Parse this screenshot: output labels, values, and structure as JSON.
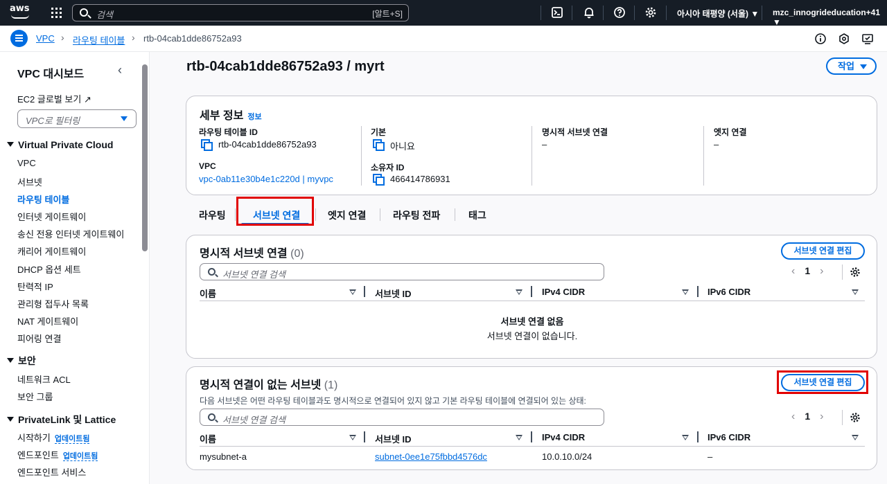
{
  "topnav": {
    "logo": "aws",
    "search_placeholder": "검색",
    "search_shortcut": "[알트+S]",
    "region": "아시아 태평양 (서울) ▼",
    "account": "mzc_innogrideducation+41 ▼",
    "icons": [
      "cloudshell-icon",
      "bell-icon",
      "help-icon",
      "gear-icon"
    ]
  },
  "breadcrumb": {
    "items": [
      "VPC",
      "라우팅 테이블",
      "rtb-04cab1dde86752a93"
    ]
  },
  "sidebar": {
    "title": "VPC 대시보드",
    "ec2_global": "EC2 글로벌 보기",
    "filter_placeholder": "VPC로 필터링",
    "sections": [
      {
        "title": "Virtual Private Cloud",
        "items": [
          "VPC",
          "서브넷",
          "라우팅 테이블",
          "인터넷 게이트웨이",
          "송신 전용 인터넷 게이트웨이",
          "캐리어 게이트웨이",
          "DHCP 옵션 세트",
          "탄력적 IP",
          "관리형 접두사 목록",
          "NAT 게이트웨이",
          "피어링 연결"
        ]
      },
      {
        "title": "보안",
        "items": [
          "네트워크 ACL",
          "보안 그룹"
        ]
      },
      {
        "title": "PrivateLink 및 Lattice",
        "items": [
          "시작하기",
          "엔드포인트",
          "엔드포인트 서비스"
        ]
      }
    ],
    "badge_update": "업데이트됨"
  },
  "page": {
    "title": "rtb-04cab1dde86752a93 / myrt",
    "action_button": "작업"
  },
  "details": {
    "header": "세부 정보",
    "info": "정보",
    "route_table_id_label": "라우팅 테이블 ID",
    "route_table_id": "rtb-04cab1dde86752a93",
    "vpc_label": "VPC",
    "vpc_value": "vpc-0ab11e30b4e1c220d | myvpc",
    "main_label": "기본",
    "main_value": "아니요",
    "owner_label": "소유자 ID",
    "owner_value": "466414786931",
    "explicit_label": "명시적 서브넷 연결",
    "explicit_value": "–",
    "edge_label": "엣지 연결",
    "edge_value": "–"
  },
  "tabs": [
    "라우팅",
    "서브넷 연결",
    "엣지 연결",
    "라우팅 전파",
    "태그"
  ],
  "explicit_panel": {
    "title": "명시적 서브넷 연결",
    "count": "(0)",
    "edit_button": "서브넷 연결 편집",
    "search_placeholder": "서브넷 연결 검색",
    "page": "1",
    "columns": [
      "이름",
      "서브넷 ID",
      "IPv4 CIDR",
      "IPv6 CIDR"
    ],
    "empty_title": "서브넷 연결 없음",
    "empty_sub": "서브넷 연결이 없습니다."
  },
  "implicit_panel": {
    "title": "명시적 연결이 없는 서브넷",
    "count": "(1)",
    "description": "다음 서브넷은 어떤 라우팅 테이블과도 명시적으로 연결되어 있지 않고 기본 라우팅 테이블에 연결되어 있는 상태:",
    "edit_button": "서브넷 연결 편집",
    "search_placeholder": "서브넷 연결 검색",
    "page": "1",
    "columns": [
      "이름",
      "서브넷 ID",
      "IPv4 CIDR",
      "IPv6 CIDR"
    ],
    "rows": [
      {
        "name": "mysubnet-a",
        "subnet_id": "subnet-0ee1e75fbbd4576dc",
        "ipv4": "10.0.10.0/24",
        "ipv6": "–"
      }
    ]
  }
}
